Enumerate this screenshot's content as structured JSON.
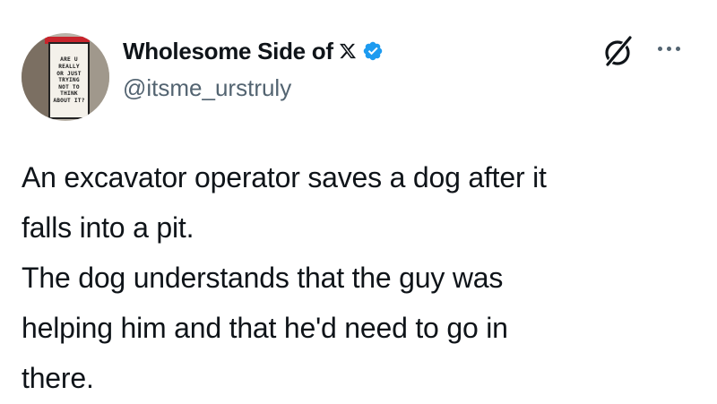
{
  "author": {
    "display_name": "Wholesome Side of",
    "handle": "@itsme_urstruly",
    "verified": true,
    "verified_color": "#1d9bf0",
    "avatar_sign_lines": [
      "ARE U",
      "REALLY",
      "OR JUST",
      "TRYING",
      "NOT TO",
      "THINK",
      "ABOUT IT?"
    ]
  },
  "icons": {
    "brand": "x-logo-icon",
    "badge": "verified-badge-icon",
    "action": "grok-icon",
    "menu": "more-options-icon"
  },
  "tweet": {
    "lines": [
      "An excavator operator saves a dog after it",
      "falls into a pit.",
      "The dog understands that the guy was",
      "helping him and that he'd need to go in",
      "there."
    ]
  },
  "colors": {
    "text": "#0f1419",
    "secondary": "#536471",
    "background": "#ffffff"
  }
}
